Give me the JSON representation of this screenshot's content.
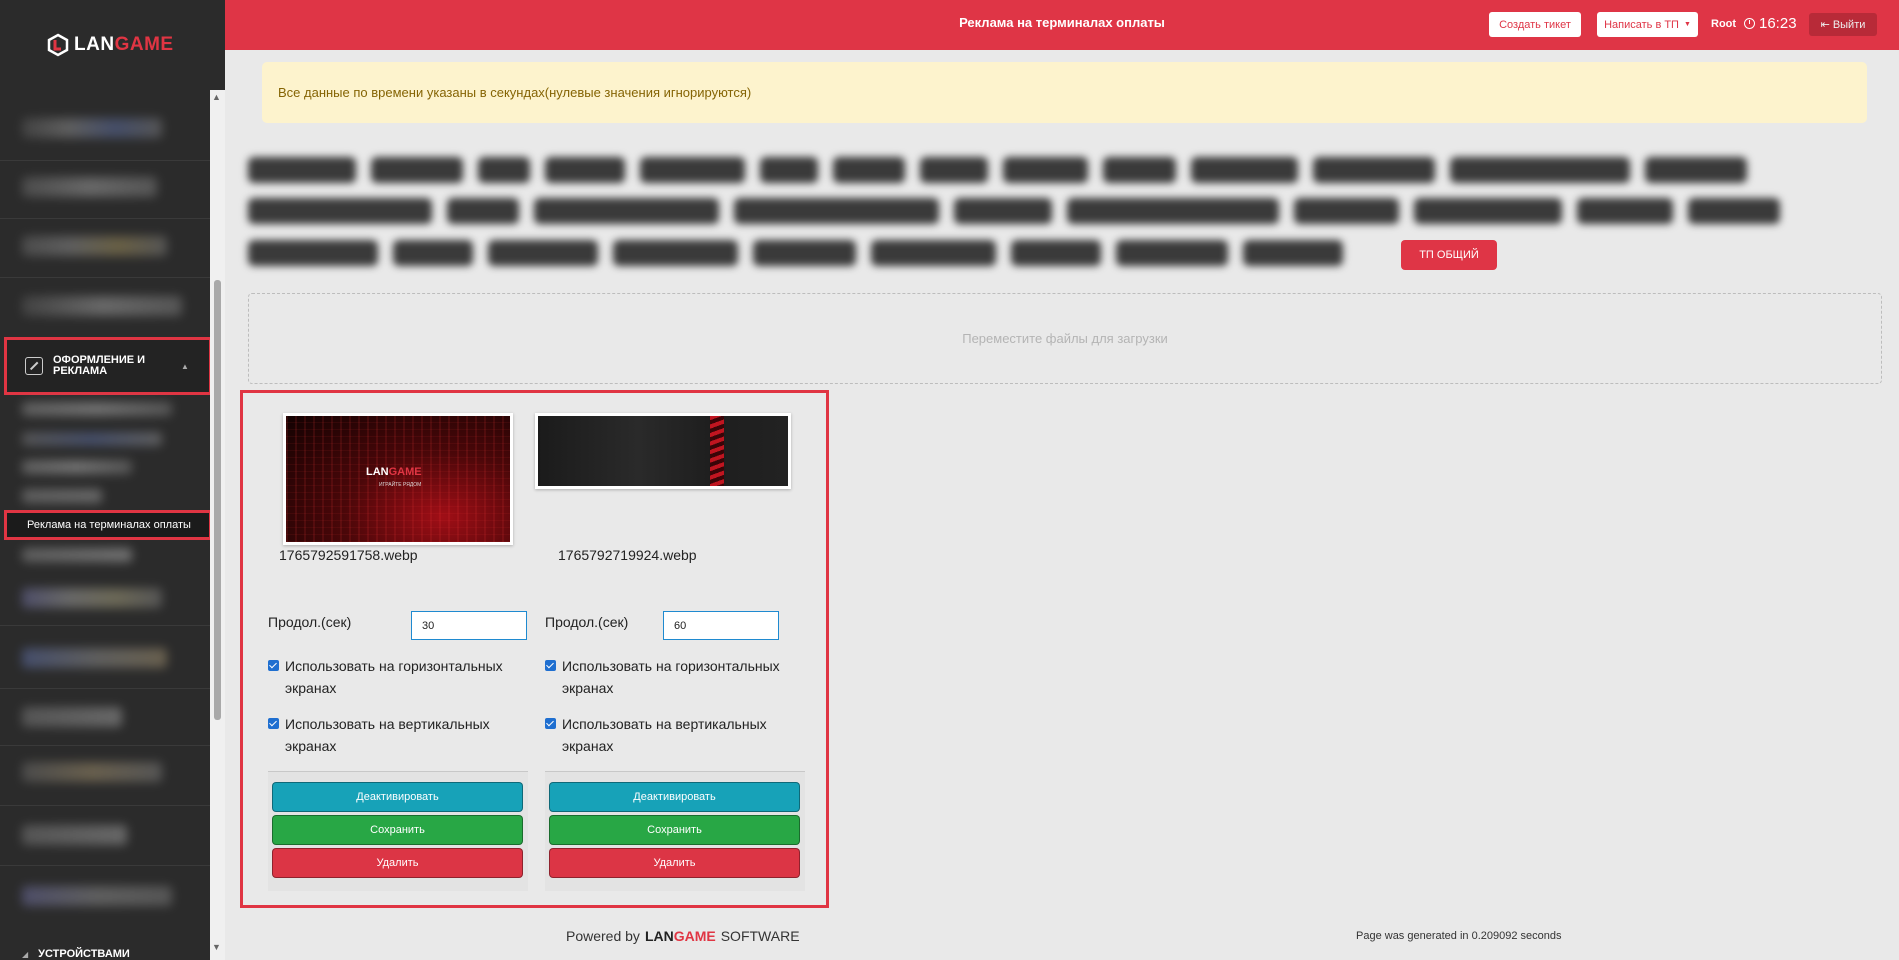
{
  "brand": {
    "part1": "LAN",
    "part2": "GAME"
  },
  "header": {
    "title": "Реклама на терминалах оплаты",
    "create_ticket": "Создать тикет",
    "write_tp": "Написать в ТП",
    "user": "Root",
    "time": "16:23",
    "logout": "Выйти"
  },
  "sidebar": {
    "active_section": "ОФОРМЛЕНИЕ И РЕКЛАМА",
    "active_item": "Реклама на терминалах оплаты",
    "bottom_item": "УСТРОЙСТВАМИ"
  },
  "notice": "Все данные по времени указаны в секундах(нулевые значения игнорируются)",
  "tags": {
    "visible_tag": "ТП ОБЩИЙ"
  },
  "dropzone": "Переместите файлы для загрузки",
  "cards": [
    {
      "filename": "1765792591758.webp",
      "thumb_brand1": "LAN",
      "thumb_brand2": "GAME",
      "thumb_slogan": "ИГРАЙТЕ РЯДОМ",
      "duration_label": "Продол.(сек)",
      "duration": "30",
      "horizontal_label": "Использовать на горизонтальных экранах",
      "vertical_label": "Использовать на вертикальных экранах",
      "deactivate": "Деактивировать",
      "save": "Сохранить",
      "delete": "Удалить"
    },
    {
      "filename": "1765792719924.webp",
      "duration_label": "Продол.(сек)",
      "duration": "60",
      "horizontal_label": "Использовать на горизонтальных экранах",
      "vertical_label": "Использовать на вертикальных экранах",
      "deactivate": "Деактивировать",
      "save": "Сохранить",
      "delete": "Удалить"
    }
  ],
  "footer": {
    "powered_by": "Powered by",
    "brand1": "LAN",
    "brand2": "GAME",
    "software": "SOFTWARE",
    "generated": "Page was generated in 0.209092 seconds"
  },
  "colors": {
    "primary_red": "#df3546",
    "info": "#17a2b8",
    "success": "#28a745",
    "danger": "#dc3545"
  }
}
